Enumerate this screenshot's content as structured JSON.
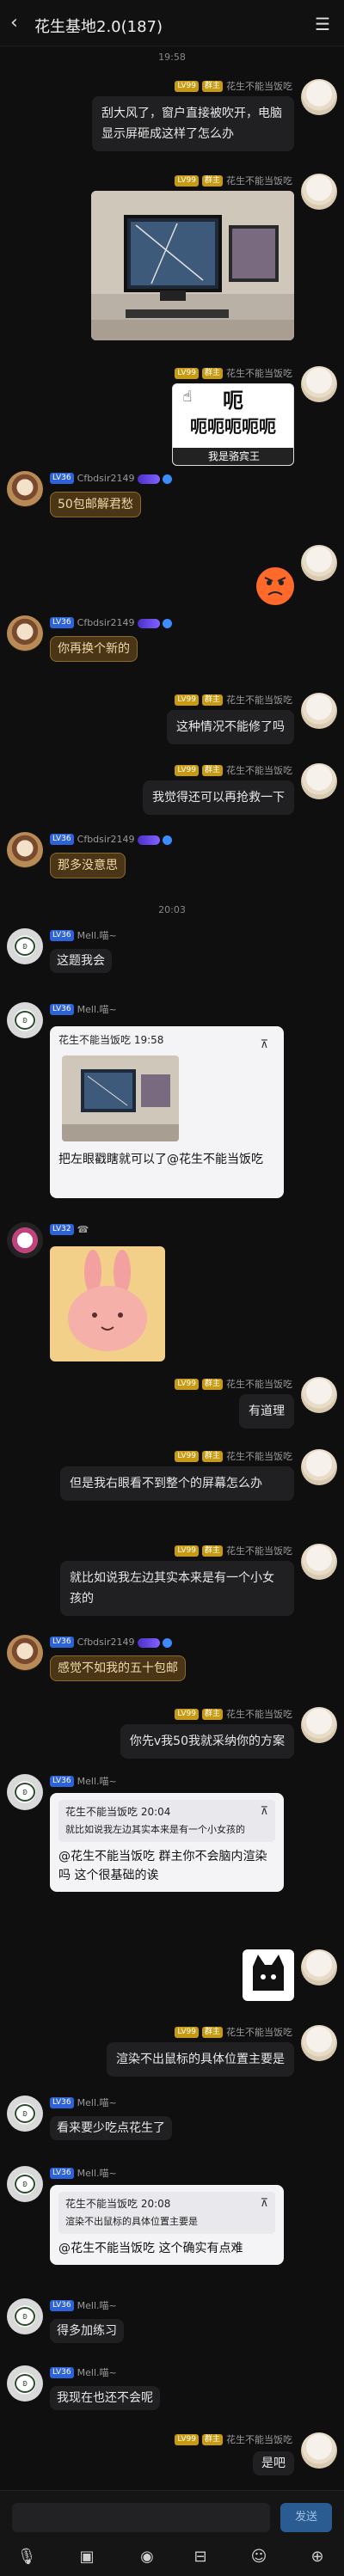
{
  "header": {
    "back_icon": "‹",
    "title": "花生基地2.0(187)",
    "menu_icon": "☰"
  },
  "times": [
    "19:58",
    "20:03"
  ],
  "self": {
    "name": "花生不能当饭吃",
    "lv": "LV99",
    "tag": "群主"
  },
  "users": {
    "cfb": {
      "name": "Cfbdsir2149",
      "lv": "LV36"
    },
    "mell": {
      "name": "Mell.喵~",
      "lv": "LV36"
    },
    "anon": {
      "lv": "LV32",
      "name": "☎"
    }
  },
  "messages": {
    "m1": "刮大风了，窗户直接被吹开，电脑显示屏砸成这样了怎么办",
    "m4": "50包邮解君愁",
    "m6": "你再换个新的",
    "m7": "这种情况不能修了吗",
    "m8": "我觉得还可以再抢救一下",
    "m9": "那多没意思",
    "m10": "这题我会",
    "m11_quote_title": "花生不能当饭吃 19:58",
    "m11_body": "把左眼戳瞎就可以了@花生不能当饭吃",
    "m13": "有道理",
    "m14": "但是我右眼看不到整个的屏幕怎么办",
    "m15": "就比如说我左边其实本来是有一个小女孩的",
    "m16": "感觉不如我的五十包邮",
    "m17": "你先v我50我就采纳你的方案",
    "m18_quote_title": "花生不能当饭吃 20:04",
    "m18_quote_text": "就比如说我左边其实本来是有一个小女孩的",
    "m18_body": "@花生不能当饭吃 群主你不会脑内渲染吗 这个很基础的诶",
    "m20": "渲染不出鼠标的具体位置主要是",
    "m21": "看来要少吃点花生了",
    "m22_quote_title": "花生不能当饭吃 20:08",
    "m22_quote_text": "渲染不出鼠标的具体位置主要是",
    "m22_body": "@花生不能当饭吃 这个确实有点难",
    "m23": "得多加练习",
    "m24": "我现在也还不会呢",
    "m25": "是吧"
  },
  "sticker": {
    "top": "呃",
    "bottom": "呃呃呃呃呃",
    "caption": "我是骆宾王"
  },
  "pin_icon": "⊼",
  "footer": {
    "send": "发送",
    "tools": [
      "mic-icon",
      "image-icon",
      "camera-icon",
      "gift-icon",
      "emoji-icon",
      "plus-icon"
    ]
  }
}
